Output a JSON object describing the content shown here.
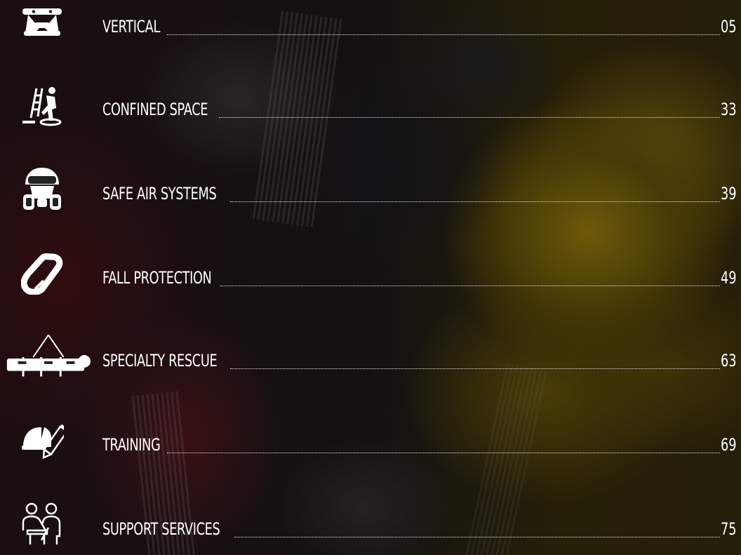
{
  "toc": {
    "entries": [
      {
        "title": "VERTICAL",
        "page": "05",
        "icon": "harness-icon"
      },
      {
        "title": "CONFINED SPACE",
        "page": "33",
        "icon": "confined-space-worker-icon"
      },
      {
        "title": "SAFE AIR SYSTEMS",
        "page": "39",
        "icon": "respirator-mask-icon"
      },
      {
        "title": "FALL PROTECTION",
        "page": "49",
        "icon": "carabiner-icon"
      },
      {
        "title": "SPECIALTY RESCUE",
        "page": "63",
        "icon": "rescue-stretcher-icon"
      },
      {
        "title": "TRAINING",
        "page": "69",
        "icon": "hardhat-pencil-icon"
      },
      {
        "title": "SUPPORT SERVICES",
        "page": "75",
        "icon": "support-people-icon"
      }
    ]
  },
  "colors": {
    "text": "#ffffff",
    "icon": "#ffffff"
  }
}
